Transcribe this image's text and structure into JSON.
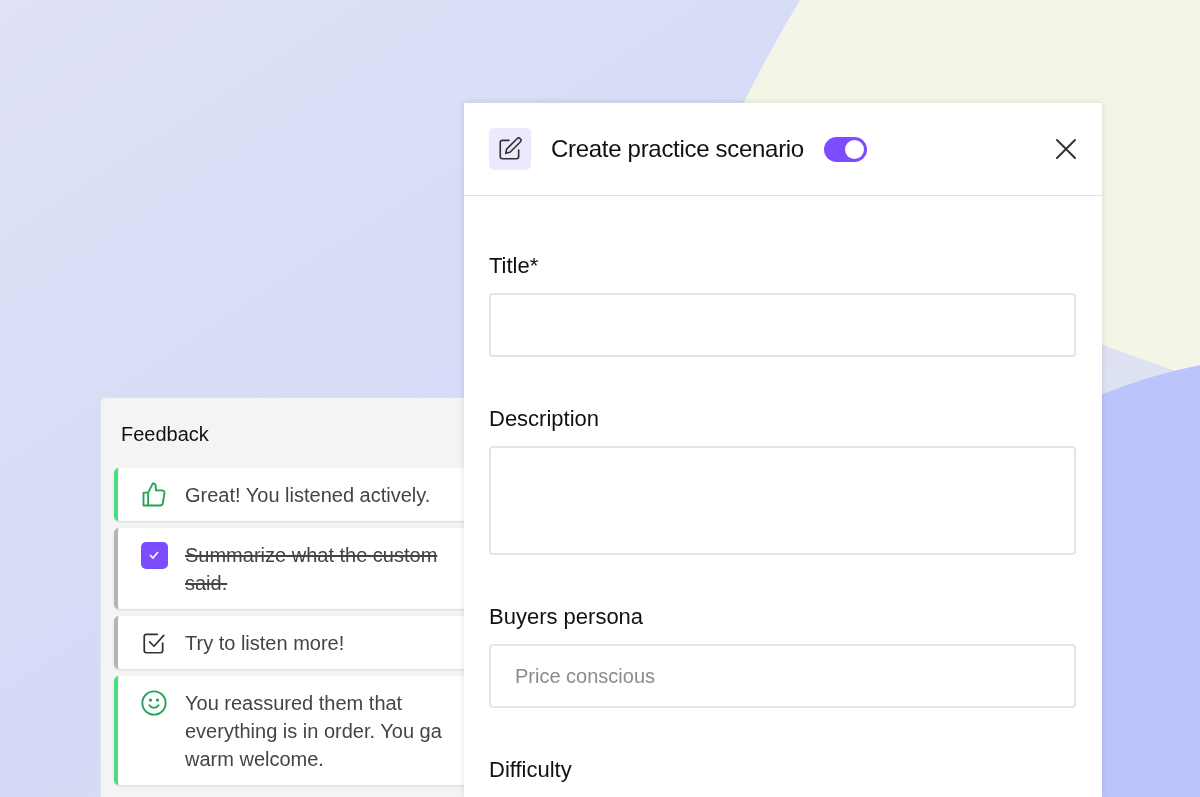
{
  "feedback": {
    "title": "Feedback",
    "items": [
      {
        "kind": "thumbs",
        "color": "#4ade80",
        "text": "Great! You listened actively."
      },
      {
        "kind": "task",
        "checked": true,
        "color": "#b4b4b8",
        "text": "Summarize what the custom\nsaid."
      },
      {
        "kind": "task",
        "checked": false,
        "color": "#b4b4b8",
        "text": "Try to listen more!"
      },
      {
        "kind": "smile",
        "color": "#4ade80",
        "text": "You reassured them that\neverything is in order. You ga\nwarm welcome."
      }
    ]
  },
  "dialog": {
    "title": "Create practice scenario",
    "toggle_on": true,
    "fields": [
      {
        "label": "Title*",
        "kind": "input"
      },
      {
        "label": "Description",
        "kind": "textarea"
      },
      {
        "label": "Buyers persona",
        "kind": "input",
        "placeholder": "Price conscious"
      },
      {
        "label": "Difficulty",
        "kind": "cut"
      }
    ]
  }
}
